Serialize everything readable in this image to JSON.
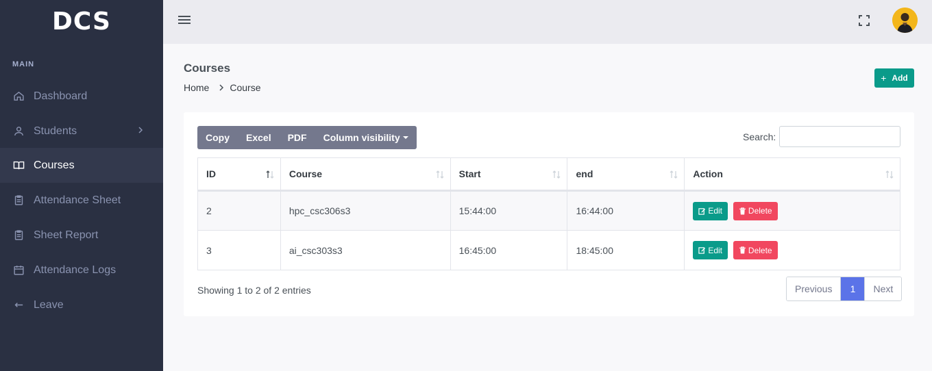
{
  "brand": "DCS",
  "sidebar": {
    "section_title": "MAIN",
    "items": [
      {
        "label": "Dashboard",
        "icon": "home-icon"
      },
      {
        "label": "Students",
        "icon": "user-icon"
      },
      {
        "label": "Courses",
        "icon": "book-icon",
        "active": true
      },
      {
        "label": "Attendance Sheet",
        "icon": "clipboard-icon"
      },
      {
        "label": "Sheet Report",
        "icon": "clipboard-icon"
      },
      {
        "label": "Attendance Logs",
        "icon": "calendar-icon"
      },
      {
        "label": "Leave",
        "icon": "arrow-left-icon"
      }
    ]
  },
  "page": {
    "title": "Courses",
    "breadcrumb": [
      "Home",
      "Course"
    ],
    "add_label": "Add"
  },
  "toolbar": {
    "buttons": [
      "Copy",
      "Excel",
      "PDF",
      "Column visibility"
    ],
    "search_label": "Search:",
    "search_value": ""
  },
  "table": {
    "columns": [
      "ID",
      "Course",
      "Start",
      "end",
      "Action"
    ],
    "rows": [
      {
        "id": "2",
        "course": "hpc_csc306s3",
        "start": "15:44:00",
        "end": "16:44:00"
      },
      {
        "id": "3",
        "course": "ai_csc303s3",
        "start": "16:45:00",
        "end": "18:45:00"
      }
    ],
    "edit_label": "Edit",
    "delete_label": "Delete"
  },
  "footer": {
    "info": "Showing 1 to 2 of 2 entries",
    "previous": "Previous",
    "current_page": "1",
    "next": "Next"
  },
  "colors": {
    "sidebar_bg": "#2a3042",
    "accent_green": "#0a9b8a",
    "danger": "#f1475f",
    "primary": "#5b73e8"
  }
}
